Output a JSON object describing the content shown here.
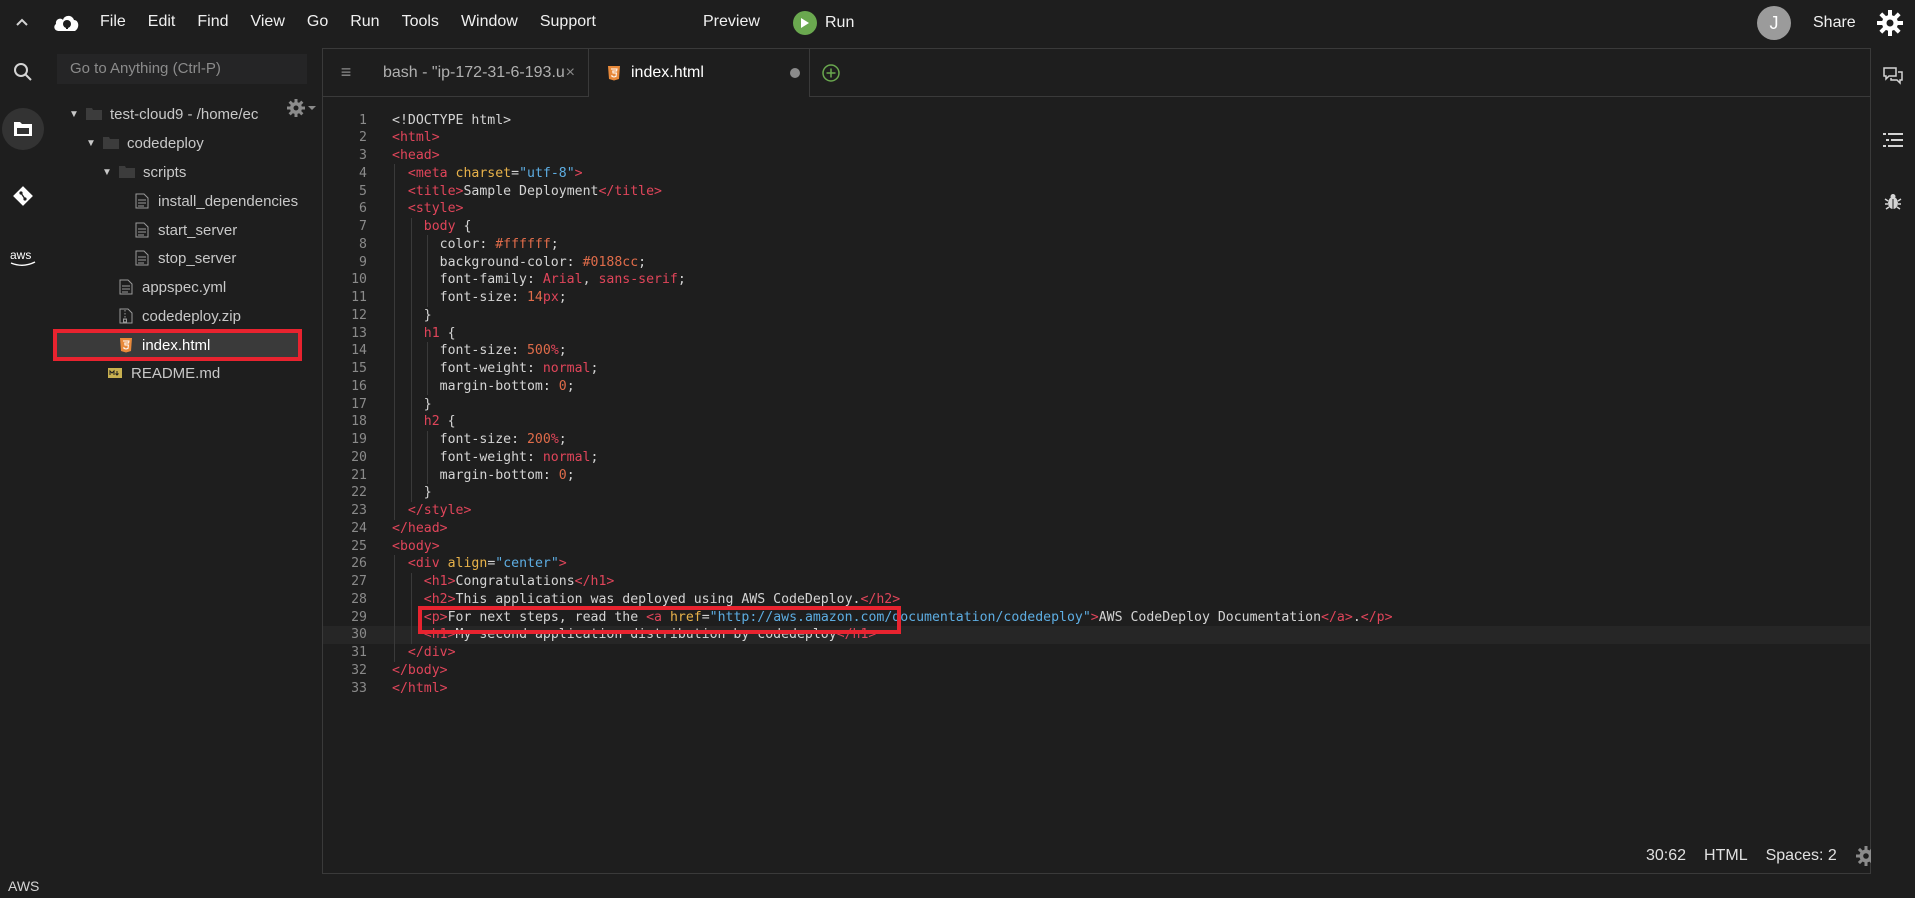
{
  "menubar": {
    "items": [
      "File",
      "Edit",
      "Find",
      "View",
      "Go",
      "Run",
      "Tools",
      "Window",
      "Support"
    ],
    "preview": "Preview",
    "run": "Run",
    "avatar": "J",
    "share": "Share"
  },
  "tree": {
    "goto_placeholder": "Go to Anything (Ctrl-P)",
    "rows": [
      {
        "label": "test-cloud9 - /home/ec",
        "kind": "folder",
        "open": true
      },
      {
        "label": "codedeploy",
        "kind": "folder",
        "open": true
      },
      {
        "label": "scripts",
        "kind": "folder",
        "open": true
      },
      {
        "label": "install_dependencies",
        "kind": "file"
      },
      {
        "label": "start_server",
        "kind": "file"
      },
      {
        "label": "stop_server",
        "kind": "file"
      },
      {
        "label": "appspec.yml",
        "kind": "file"
      },
      {
        "label": "codedeploy.zip",
        "kind": "zip"
      },
      {
        "label": "index.html",
        "kind": "html"
      },
      {
        "label": "README.md",
        "kind": "md"
      }
    ]
  },
  "tabs": {
    "bash": "bash - \"ip-172-31-6-193.u",
    "index": "index.html"
  },
  "code": {
    "cursor_line": 30,
    "lines": [
      "<!DOCTYPE html>",
      "<html>",
      "<head>",
      "  <meta charset=\"utf-8\">",
      "  <title>Sample Deployment</title>",
      "  <style>",
      "    body {",
      "      color: #ffffff;",
      "      background-color: #0188cc;",
      "      font-family: Arial, sans-serif;",
      "      font-size: 14px;",
      "    }",
      "    h1 {",
      "      font-size: 500%;",
      "      font-weight: normal;",
      "      margin-bottom: 0;",
      "    }",
      "    h2 {",
      "      font-size: 200%;",
      "      font-weight: normal;",
      "      margin-bottom: 0;",
      "    }",
      "  </style>",
      "</head>",
      "<body>",
      "  <div align=\"center\">",
      "    <h1>Congratulations</h1>",
      "    <h2>This application was deployed using AWS CodeDeploy.</h2>",
      "    <p>For next steps, read the <a href=\"http://aws.amazon.com/documentation/codedeploy\">AWS CodeDeploy Documentation</a>.</p>",
      "    <h1>My second application distribution by codedeploy</h1>",
      "  </div>",
      "</body>",
      "</html>"
    ]
  },
  "status": {
    "position": "30:62",
    "language": "HTML",
    "indent": "Spaces: 2"
  },
  "footer": {
    "label": "AWS"
  },
  "colors": {
    "highlight": "#e8232f",
    "tag": "#e0455a",
    "attr": "#e8b24a",
    "string": "#5dade2"
  }
}
